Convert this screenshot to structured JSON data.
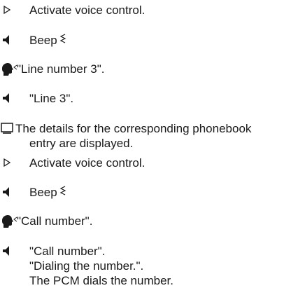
{
  "steps": [
    {
      "icon": "triangle-right-icon",
      "text": "Activate voice control."
    },
    {
      "icon": "speaker-icon",
      "text": "Beep",
      "wave": "sound-wave-icon"
    },
    {
      "icon": "speaking-head-icon",
      "text": "\"Line number 3\"."
    },
    {
      "icon": "speaker-icon",
      "text": "\"Line 3\"."
    },
    {
      "icon": "display-icon",
      "lines": [
        "The details for the corresponding phonebook",
        "entry are displayed."
      ]
    },
    {
      "icon": "triangle-right-icon",
      "text": "Activate voice control."
    },
    {
      "icon": "speaker-icon",
      "text": "Beep",
      "wave": "sound-wave-icon"
    },
    {
      "icon": "speaking-head-icon",
      "text": "\"Call number\"."
    },
    {
      "icon": "speaker-icon",
      "lines": [
        "\"Call number\".",
        "\"Dialing the number.\".",
        "The PCM dials the number."
      ]
    }
  ]
}
